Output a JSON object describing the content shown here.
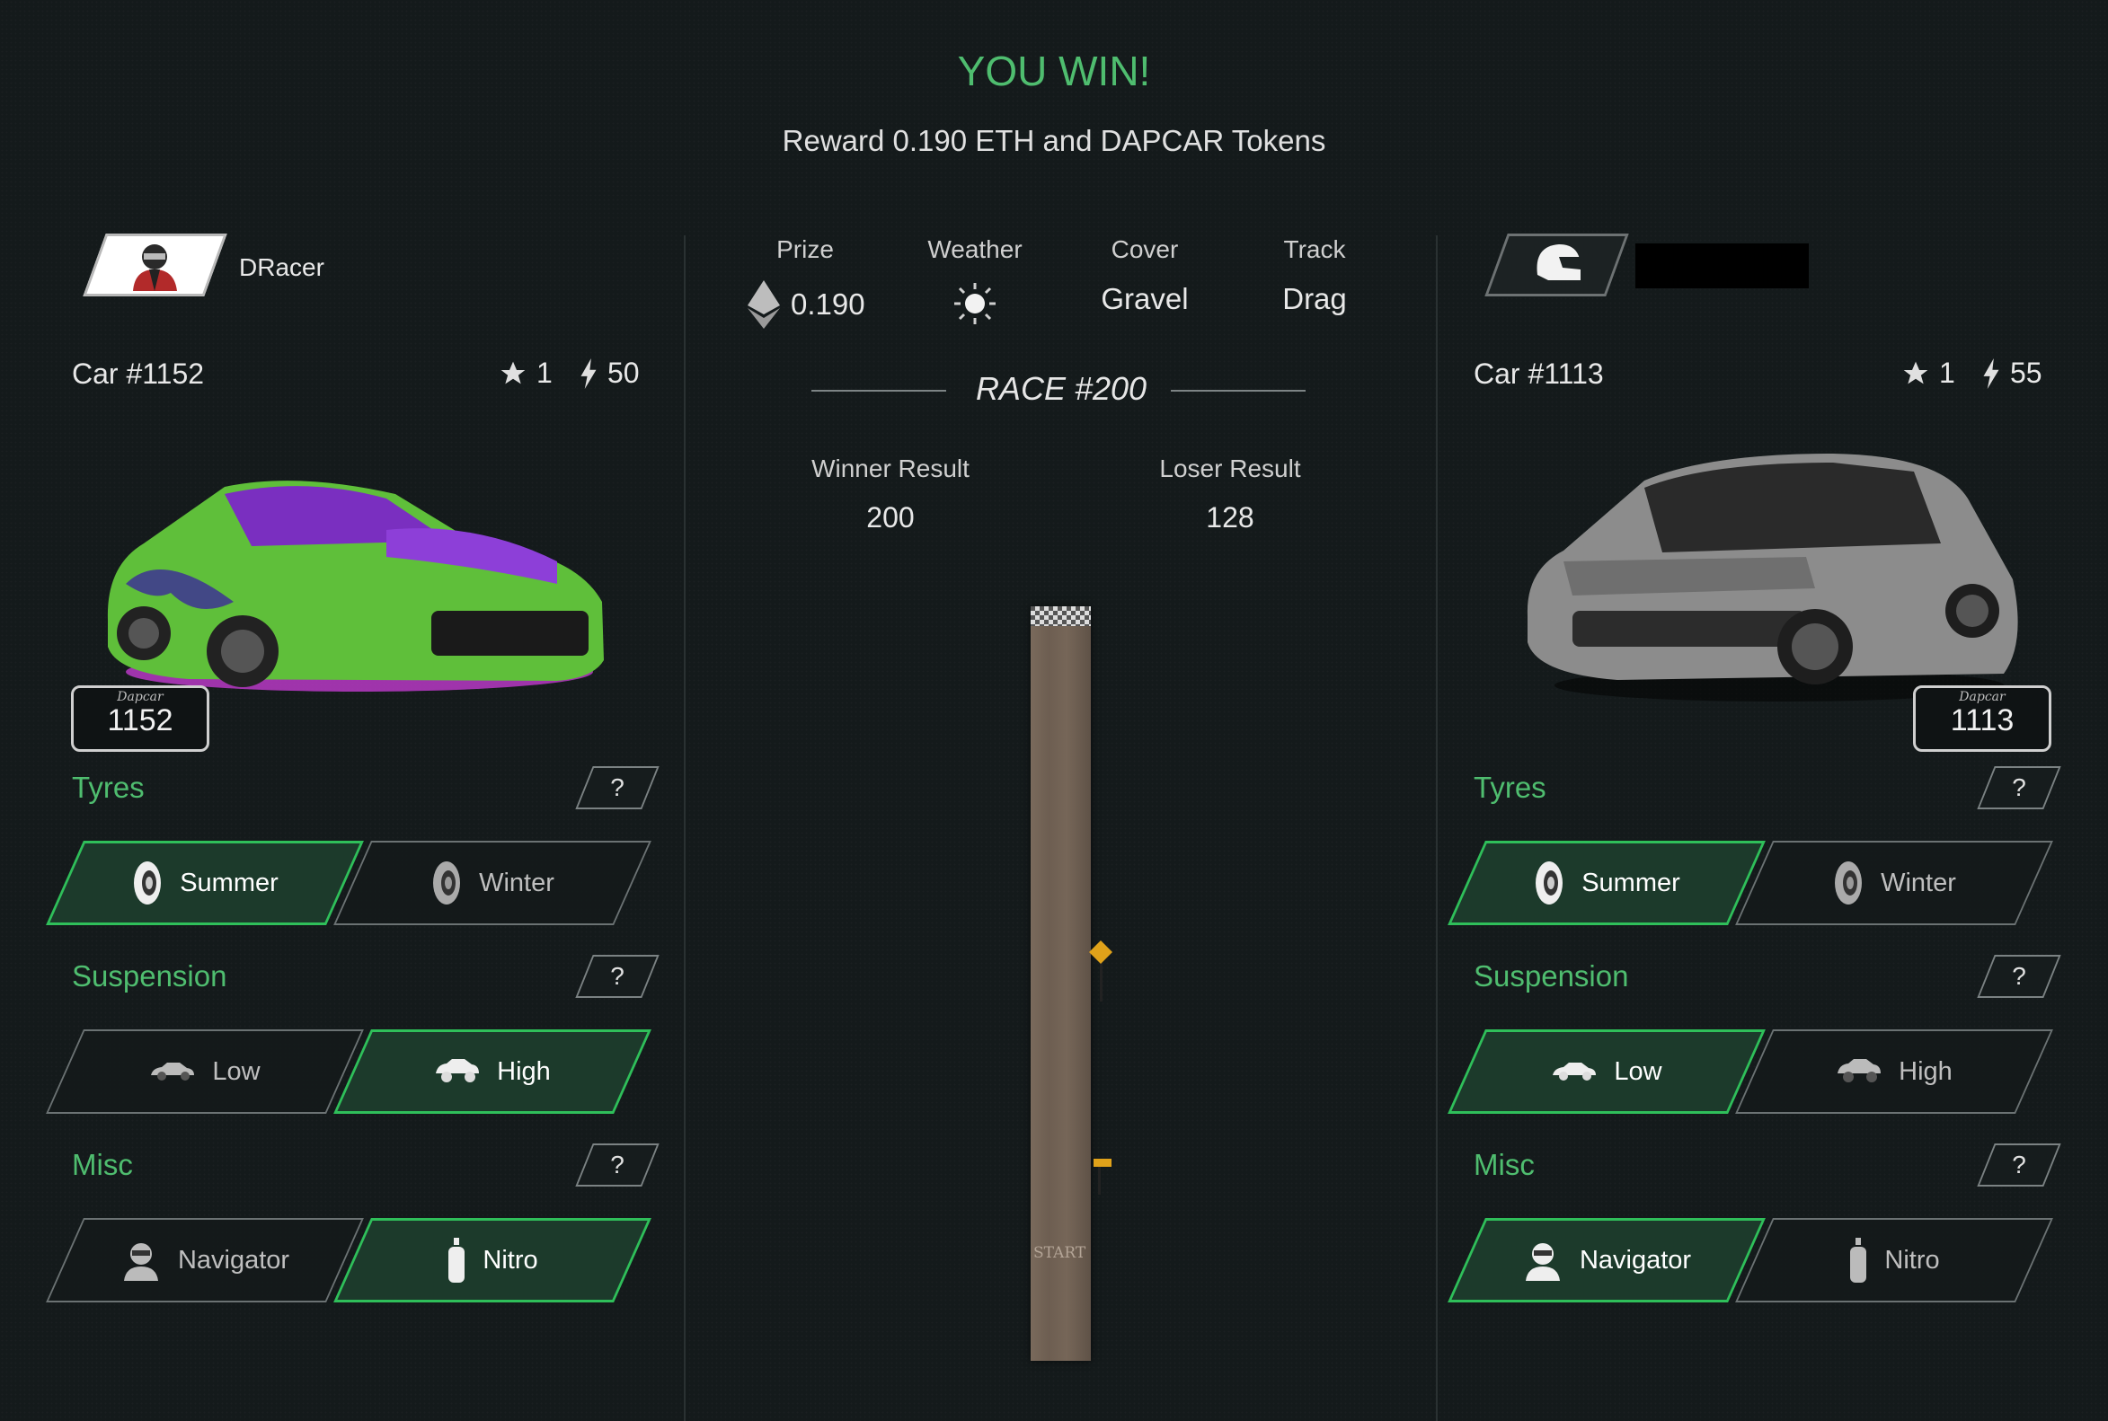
{
  "header": {
    "title": "YOU WIN!",
    "subtitle": "Reward 0.190 ETH and DAPCAR Tokens"
  },
  "race_info": {
    "prize_label": "Prize",
    "prize_value": "0.190",
    "weather_label": "Weather",
    "weather_icon": "sun-icon",
    "cover_label": "Cover",
    "cover_value": "Gravel",
    "track_label": "Track",
    "track_value": "Drag"
  },
  "race": {
    "title": "RACE #200",
    "winner_label": "Winner Result",
    "winner_value": "200",
    "loser_label": "Loser Result",
    "loser_value": "128",
    "start_label": "START"
  },
  "left": {
    "player_name": "DRacer",
    "car_label": "Car #1152",
    "stars": "1",
    "power": "50",
    "plate_brand": "Dapcar",
    "plate_number": "1152",
    "car_color": "#5fbf3a",
    "sections": {
      "tyres": "Tyres",
      "suspension": "Suspension",
      "misc": "Misc",
      "help": "?"
    },
    "tyres": [
      {
        "label": "Summer"
      },
      {
        "label": "Winter"
      }
    ],
    "suspension": [
      {
        "label": "Low"
      },
      {
        "label": "High"
      }
    ],
    "misc": [
      {
        "label": "Navigator"
      },
      {
        "label": "Nitro"
      }
    ]
  },
  "right": {
    "car_label": "Car #1113",
    "stars": "1",
    "power": "55",
    "plate_brand": "Dapcar",
    "plate_number": "1113",
    "car_color": "#8c8c8c",
    "sections": {
      "tyres": "Tyres",
      "suspension": "Suspension",
      "misc": "Misc",
      "help": "?"
    },
    "tyres": [
      {
        "label": "Summer"
      },
      {
        "label": "Winter"
      }
    ],
    "suspension": [
      {
        "label": "Low"
      },
      {
        "label": "High"
      }
    ],
    "misc": [
      {
        "label": "Navigator"
      },
      {
        "label": "Nitro"
      }
    ]
  },
  "colors": {
    "accent": "#4fbd6f",
    "selected_border": "#2fbf5a",
    "selected_fill": "#1c3a2b",
    "background": "#141a1b"
  }
}
